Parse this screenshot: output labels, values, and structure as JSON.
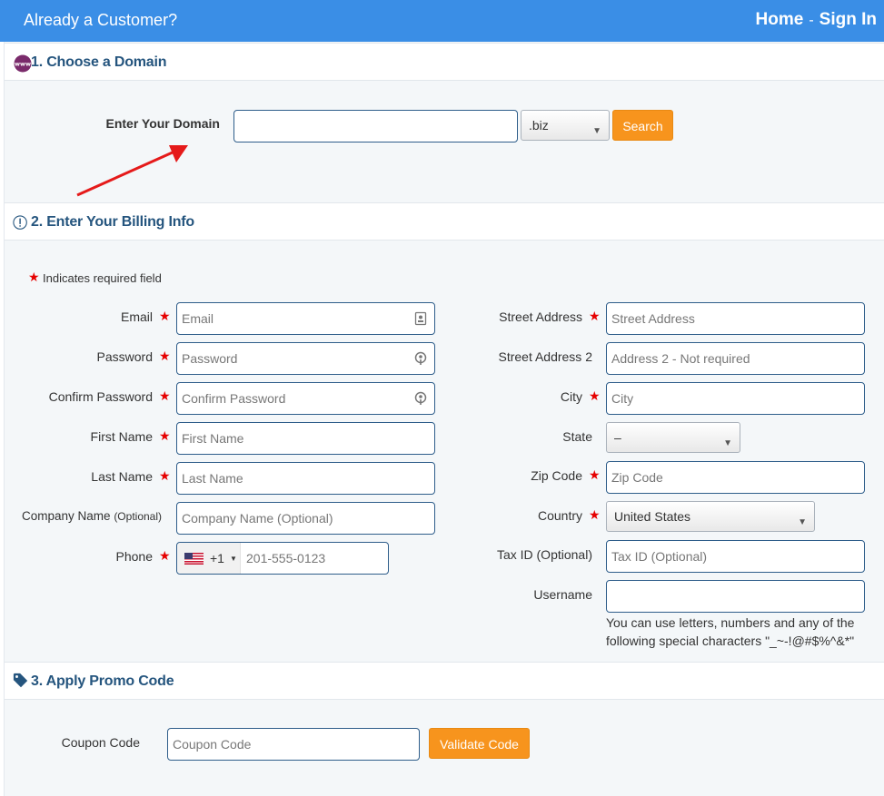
{
  "header": {
    "title": "Already a Customer?",
    "home": "Home",
    "separator": "-",
    "signin": "Sign In"
  },
  "domain_section": {
    "title": "1. Choose a Domain",
    "label": "Enter Your Domain",
    "input_value": "",
    "tld": ".biz",
    "search": "Search"
  },
  "billing_section": {
    "title": "2. Enter Your Billing Info",
    "required_note": "Indicates required field",
    "required_mark": "★",
    "email": {
      "label": "Email",
      "placeholder": "Email"
    },
    "password": {
      "label": "Password",
      "placeholder": "Password"
    },
    "confirm_password": {
      "label": "Confirm Password",
      "placeholder": "Confirm Password"
    },
    "first_name": {
      "label": "First Name",
      "placeholder": "First Name"
    },
    "last_name": {
      "label": "Last Name",
      "placeholder": "Last Name"
    },
    "company": {
      "label": "Company Name",
      "label_optional": "(Optional)",
      "placeholder": "Company Name  (Optional)"
    },
    "phone": {
      "label": "Phone",
      "country_code": "+1",
      "placeholder": "201-555-0123"
    },
    "street": {
      "label": "Street Address",
      "placeholder": "Street Address"
    },
    "street2": {
      "label": "Street Address 2",
      "placeholder": "Address 2 - Not required"
    },
    "city": {
      "label": "City",
      "placeholder": "City"
    },
    "state": {
      "label": "State",
      "value": "–"
    },
    "zip": {
      "label": "Zip Code",
      "placeholder": "Zip Code"
    },
    "country": {
      "label": "Country",
      "value": "United States"
    },
    "tax": {
      "label": "Tax ID (Optional)",
      "placeholder": "Tax ID (Optional)"
    },
    "username": {
      "label": "Username",
      "value": "",
      "help_line1": "You can use letters, numbers and any of the",
      "help_line2": "following special characters \"_~-!@#$%^&*\""
    }
  },
  "promo_section": {
    "title": "3. Apply Promo Code",
    "label": "Coupon Code",
    "placeholder": "Coupon Code",
    "button": "Validate Code"
  },
  "colors": {
    "header_bg": "#3a8ee6",
    "section_title": "#25557e",
    "button": "#f7941d",
    "required": "#e60000",
    "arrow": "#e51a1a"
  }
}
